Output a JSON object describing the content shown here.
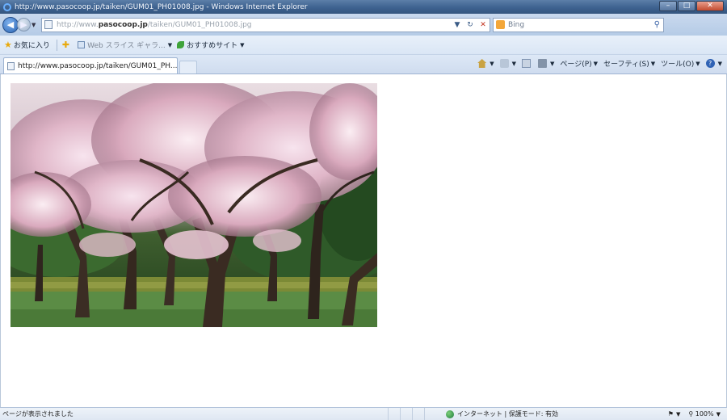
{
  "window": {
    "title": "http://www.pasocoop.jp/taiken/GUM01_PH01008.jpg - Windows Internet Explorer",
    "minimize_label": "–",
    "maximize_label": "□",
    "close_label": "✕"
  },
  "address_bar": {
    "url_prefix": "http://www.",
    "url_domain": "pasocoop.jp",
    "url_path": "/taiken/GUM01_PH01008.jpg"
  },
  "search": {
    "placeholder": "Bing"
  },
  "favorites_bar": {
    "favorites_label": "お気に入り",
    "web_slice_label": "Web スライス ギャラ...",
    "suggested_sites_label": "おすすめサイト"
  },
  "tab": {
    "title": "http://www.pasocoop.jp/taiken/GUM01_PH..."
  },
  "command_bar": {
    "page_label": "ページ(P)",
    "safety_label": "セーフティ(S)",
    "tools_label": "ツール(O)"
  },
  "status_bar": {
    "status_text": "ページが表示されました",
    "zone_text": "インターネット | 保護モード: 有効",
    "zoom_text": "100%"
  },
  "content": {
    "image_alt": "cherry blossom trees in a park"
  }
}
